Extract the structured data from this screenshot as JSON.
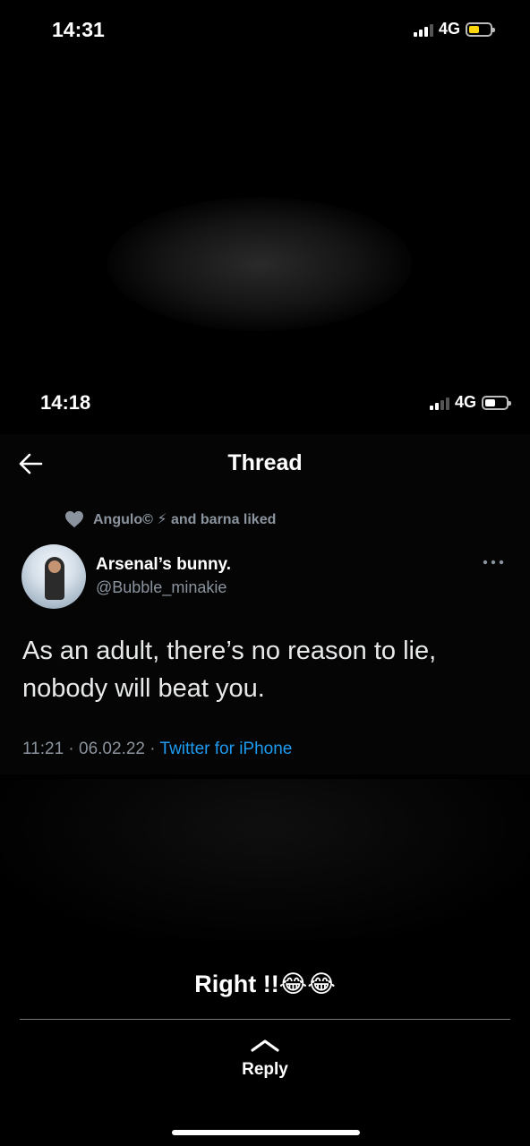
{
  "outer_status": {
    "time": "14:31",
    "network": "4G",
    "battery_color": "#ffd60a"
  },
  "inner_status": {
    "time": "14:18",
    "network": "4G",
    "battery_color": "#ffffff"
  },
  "header": {
    "title": "Thread",
    "back_icon": "back-arrow-icon"
  },
  "social_context": {
    "text": "Angulo© ⚡ and barna liked",
    "icon": "heart-icon"
  },
  "tweet": {
    "display_name": "Arsenal’s bunny.",
    "handle": "@Bubble_minakie",
    "text": "As an adult, there’s no reason to lie, nobody will beat you.",
    "time": "11:21 · 06.02.22 · ",
    "source": "Twitter for iPhone"
  },
  "caption": {
    "text": "Right !!😂😂"
  },
  "reply": {
    "label": "Reply",
    "icon": "chevron-up-icon"
  },
  "colors": {
    "link": "#1d9bf0",
    "muted": "#8b949e",
    "background": "#000000"
  }
}
